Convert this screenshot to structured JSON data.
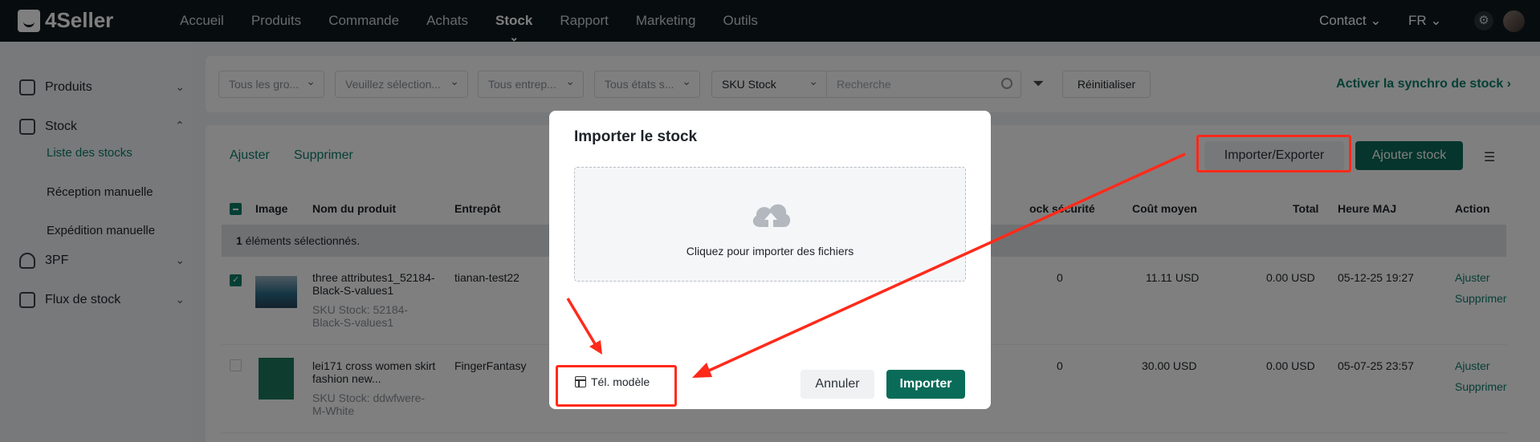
{
  "app": {
    "brand": "4Seller"
  },
  "nav": {
    "items": [
      "Accueil",
      "Produits",
      "Commande",
      "Achats",
      "Stock",
      "Rapport",
      "Marketing",
      "Outils"
    ],
    "active": "Stock",
    "contact": "Contact ⌄",
    "lang": "FR ⌄",
    "gear_icon": "gear-icon"
  },
  "sidebar": {
    "produits": "Produits",
    "stock": "Stock",
    "sub": [
      "Liste des stocks",
      "Réception manuelle",
      "Expédition manuelle"
    ],
    "tpf": "3PF",
    "flux": "Flux de stock"
  },
  "filters": {
    "group": "Tous les gro...",
    "select": "Veuillez sélection...",
    "warehouse": "Tous entrep...",
    "states": "Tous états s...",
    "sku_type": "SKU Stock",
    "search_placeholder": "Recherche",
    "reset": "Réinitialiser",
    "sync": "Activer la synchro de stock ›"
  },
  "actions": {
    "adjust": "Ajuster",
    "delete": "Supprimer",
    "import_export": "Importer/Exporter",
    "add_stock": "Ajouter stock"
  },
  "table": {
    "headers": {
      "image": "Image",
      "name": "Nom du produit",
      "warehouse": "Entrepôt",
      "safety": "ock sécurité",
      "avg_cost": "Coût moyen",
      "total": "Total",
      "updated": "Heure MAJ",
      "action": "Action"
    },
    "selected_count": "1",
    "selected_text": " éléments sélectionnés.",
    "rows": [
      {
        "name": "three attributes1_52184-Black-S-values1",
        "sku": "SKU Stock: 52184-Black-S-values1",
        "warehouse": "tianan-test22",
        "safety": "0",
        "avg_cost": "11.11  USD",
        "total": "0.00  USD",
        "updated": "05-12-25 19:27",
        "adjust": "Ajuster",
        "delete": "Supprimer"
      },
      {
        "name": "lei171 cross women skirt fashion new...",
        "sku": "SKU Stock: ddwfwere-M-White",
        "warehouse": "FingerFantasy",
        "safety": "0",
        "avg_cost": "30.00  USD",
        "total": "0.00  USD",
        "updated": "05-07-25 23:57",
        "adjust": "Ajuster",
        "delete": "Supprimer"
      }
    ]
  },
  "modal": {
    "title": "Importer le stock",
    "dropzone_text": "Cliquez pour importer des fichiers",
    "template_link": "Tél. modèle",
    "cancel": "Annuler",
    "import": "Importer"
  },
  "colors": {
    "accent": "#0a6b59",
    "annotation": "#ff2a1a"
  }
}
